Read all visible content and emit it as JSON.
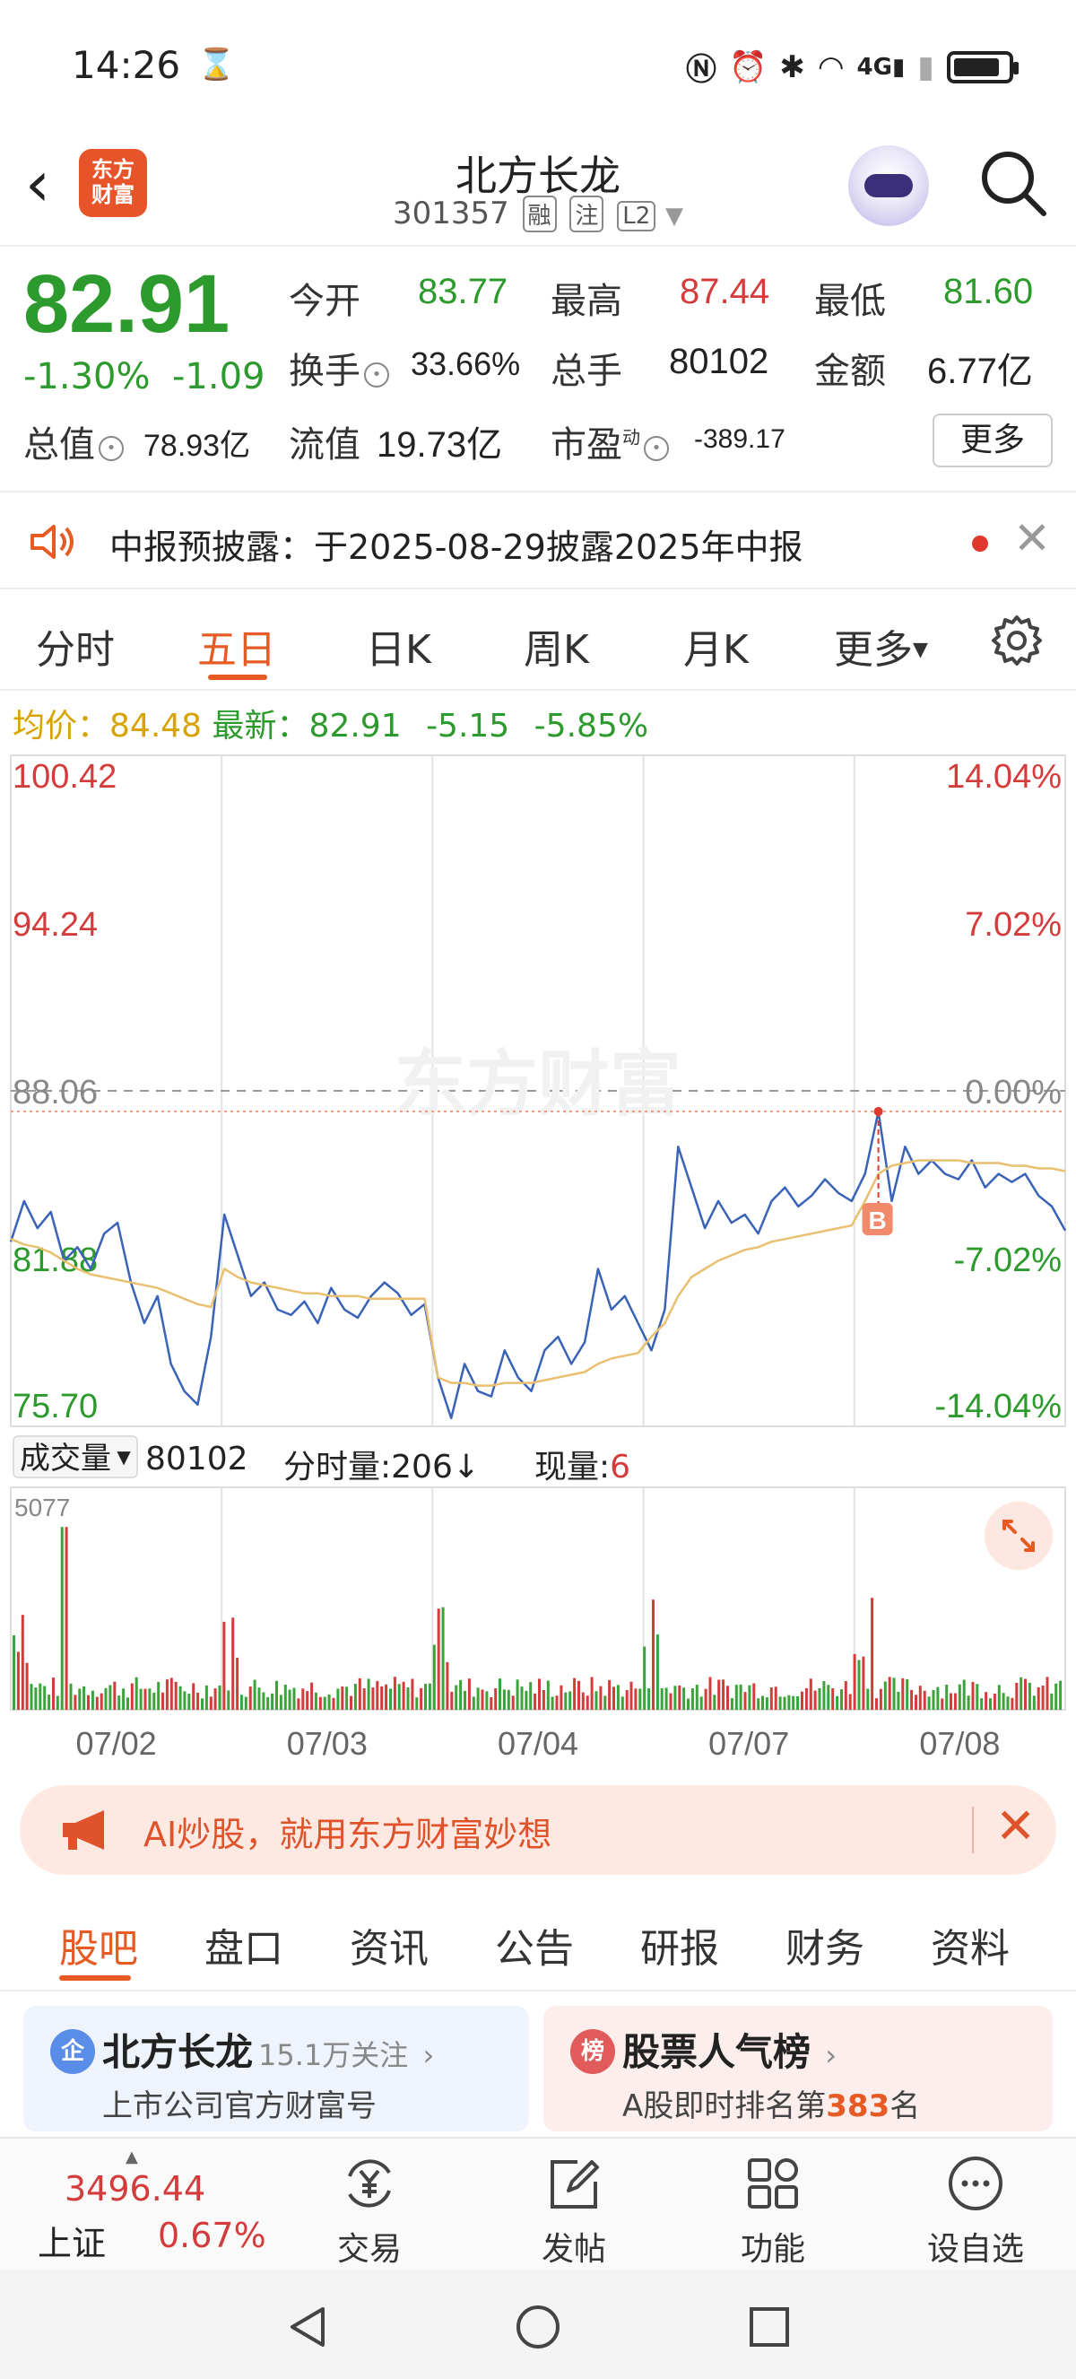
{
  "status_bar": {
    "time": "14:26",
    "icons": [
      "hourglass-icon",
      "nfc-icon",
      "alarm-icon",
      "bluetooth-icon",
      "wifi-icon",
      "signal-4g-icon",
      "signal-icon",
      "battery-icon"
    ]
  },
  "header": {
    "logo_text_1": "东方",
    "logo_text_2": "财富",
    "title": "北方长龙",
    "code": "301357",
    "tags": [
      "融",
      "注",
      "L2"
    ]
  },
  "quote": {
    "price": "82.91",
    "change_pct": "-1.30%",
    "change": "-1.09",
    "open_label": "今开",
    "open": "83.77",
    "high_label": "最高",
    "high": "87.44",
    "low_label": "最低",
    "low": "81.60",
    "turnover_label": "换手",
    "turnover": "33.66%",
    "volume_label": "总手",
    "volume": "80102",
    "amount_label": "金额",
    "amount": "6.77亿",
    "mktcap_label": "总值",
    "mktcap": "78.93亿",
    "float_label": "流值",
    "float": "19.73亿",
    "pe_label": "市盈",
    "pe_sup": "动",
    "pe": "-389.17",
    "more_label": "更多"
  },
  "notice": {
    "text": "中报预披露：于2025-08-29披露2025年中报"
  },
  "tabs": {
    "items": [
      "分时",
      "五日",
      "日K",
      "周K",
      "月K",
      "更多"
    ],
    "active": "五日"
  },
  "avg_line": {
    "avg_label": "均价：",
    "avg": "84.48",
    "latest_label": "最新：",
    "latest": "82.91",
    "chg": "-5.15",
    "pct": "-5.85%"
  },
  "chart_data": {
    "type": "line",
    "title": "",
    "x": [
      "07/02",
      "07/03",
      "07/04",
      "07/07",
      "07/08"
    ],
    "y_left_ticks": [
      "100.42",
      "94.24",
      "88.06",
      "81.88",
      "75.70"
    ],
    "y_right_ticks": [
      "14.04%",
      "7.02%",
      "0.00%",
      "-7.02%",
      "-14.04%"
    ],
    "ylim": [
      75.7,
      100.42
    ],
    "prev_close": 88.06,
    "series": [
      {
        "name": "价格",
        "color": "#3a63b8",
        "values": [
          82.5,
          84.0,
          83.0,
          83.6,
          81.8,
          82.3,
          81.5,
          82.8,
          83.2,
          81.0,
          79.5,
          80.5,
          78.0,
          77.0,
          76.5,
          79.0,
          83.5,
          82.0,
          80.5,
          81.0,
          80.0,
          79.8,
          80.3,
          79.5,
          80.8,
          80.0,
          79.7,
          80.5,
          81.0,
          80.6,
          79.8,
          80.2,
          77.5,
          76.0,
          78.0,
          77.0,
          76.8,
          78.5,
          77.5,
          77.0,
          78.5,
          79.0,
          78.0,
          78.8,
          81.5,
          80.0,
          80.5,
          79.5,
          78.5,
          80.0,
          86.0,
          84.5,
          83.0,
          84.0,
          83.2,
          83.5,
          82.8,
          84.0,
          84.5,
          83.8,
          84.2,
          84.8,
          84.3,
          84.0,
          85.0,
          87.3,
          84.0,
          86.0,
          85.0,
          85.5,
          85.0,
          84.8,
          85.5,
          84.5,
          85.0,
          84.7,
          85.0,
          84.2,
          83.8,
          82.91
        ]
      },
      {
        "name": "均价",
        "color": "#e8c070",
        "values": [
          82.6,
          82.4,
          82.3,
          82.1,
          81.8,
          81.5,
          81.3,
          81.2,
          81.1,
          81.0,
          80.9,
          80.8,
          80.6,
          80.4,
          80.2,
          80.1,
          81.5,
          81.2,
          81.0,
          80.9,
          80.8,
          80.7,
          80.6,
          80.6,
          80.5,
          80.5,
          80.5,
          80.4,
          80.4,
          80.4,
          80.4,
          80.4,
          77.5,
          77.3,
          77.3,
          77.2,
          77.2,
          77.3,
          77.3,
          77.3,
          77.4,
          77.5,
          77.6,
          77.7,
          78.0,
          78.2,
          78.3,
          78.4,
          79.0,
          79.5,
          80.5,
          81.2,
          81.5,
          81.8,
          82.0,
          82.2,
          82.3,
          82.5,
          82.6,
          82.7,
          82.8,
          82.9,
          83.0,
          83.1,
          84.0,
          85.0,
          85.3,
          85.4,
          85.5,
          85.5,
          85.5,
          85.5,
          85.4,
          85.4,
          85.4,
          85.3,
          85.3,
          85.2,
          85.2,
          85.1
        ]
      }
    ],
    "buy_marker": "B",
    "volume": {
      "label": "成交量",
      "total": "80102",
      "tick_label": "分时量:206↓",
      "now_label": "现量:",
      "now": "6",
      "max_label": "5077"
    },
    "grid": true,
    "legend": "none"
  },
  "banner": {
    "text": "AI炒股，就用东方财富妙想"
  },
  "bottom_tabs": {
    "items": [
      "股吧",
      "盘口",
      "资讯",
      "公告",
      "研报",
      "财务",
      "资料"
    ],
    "active": "股吧"
  },
  "cards": [
    {
      "icon": "企",
      "title": "北方长龙",
      "follow": "15.1万关注",
      "sub": "上市公司官方财富号"
    },
    {
      "icon": "榜",
      "title": "股票人气榜",
      "sub_prefix": "A股即时排名第",
      "rank": "383",
      "sub_suffix": "名"
    }
  ],
  "toolbar": {
    "index_value": "3496.44",
    "index_name": "上证",
    "index_pct": "0.67%",
    "items": [
      "交易",
      "发帖",
      "功能",
      "设自选"
    ]
  },
  "colors": {
    "accent": "#e65a24",
    "up": "#d43c3c",
    "down": "#2c9a2c"
  }
}
